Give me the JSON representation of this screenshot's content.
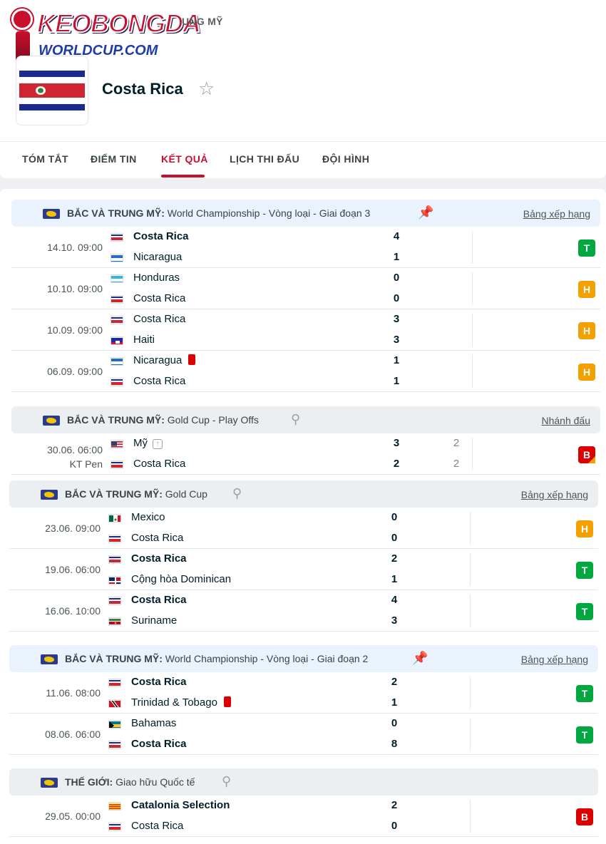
{
  "breadcrumb": "UNG MỸ",
  "logo": {
    "line1": "KEOBONGDA",
    "line2": "WORLDCUP.COM"
  },
  "team": {
    "name": "Costa Rica",
    "flag": "cr"
  },
  "tabs": [
    {
      "label": "TÓM TẮT"
    },
    {
      "label": "ĐIỂM TIN"
    },
    {
      "label": "KẾT QUẢ"
    },
    {
      "label": "LỊCH THI ĐẤU"
    },
    {
      "label": "ĐỘI HÌNH"
    }
  ],
  "sections": [
    {
      "region": "BẮC VÀ TRUNG MỸ:",
      "competition": "World Championship - Vòng loại - Giai đoạn 3",
      "pinned": true,
      "link": "Bảng xếp hạng",
      "matches": [
        {
          "time": "14.10. 09:00",
          "home": "Costa Rica",
          "home_flag": "cr",
          "away": "Nicaragua",
          "away_flag": "ni",
          "hs": "4",
          "as": "1",
          "result": "T",
          "winner": "home"
        },
        {
          "time": "10.10. 09:00",
          "home": "Honduras",
          "home_flag": "hn",
          "away": "Costa Rica",
          "away_flag": "cr",
          "hs": "0",
          "as": "0",
          "result": "H"
        },
        {
          "time": "10.09. 09:00",
          "home": "Costa Rica",
          "home_flag": "cr",
          "away": "Haiti",
          "away_flag": "ht",
          "hs": "3",
          "as": "3",
          "result": "H"
        },
        {
          "time": "06.09. 09:00",
          "home": "Nicaragua",
          "home_flag": "ni",
          "away": "Costa Rica",
          "away_flag": "cr",
          "hs": "1",
          "as": "1",
          "result": "H",
          "home_redcard": true
        }
      ]
    },
    {
      "region": "BẮC VÀ TRUNG MỸ:",
      "competition": "Gold Cup - Play Offs",
      "pinned": false,
      "link": "Nhánh đấu",
      "matches": [
        {
          "time": "30.06. 06:00",
          "status": "KT Pen",
          "home": "Mỹ",
          "home_flag": "us",
          "away": "Costa Rica",
          "away_flag": "cr",
          "hs": "3",
          "as": "2",
          "hp": "2",
          "ap": "2",
          "result": "B",
          "home_up": true
        }
      ]
    },
    {
      "region": "BẮC VÀ TRUNG MỸ:",
      "competition": "Gold Cup",
      "pinned": false,
      "link": "Bảng xếp hạng",
      "matches": [
        {
          "time": "23.06. 09:00",
          "home": "Mexico",
          "home_flag": "mx",
          "away": "Costa Rica",
          "away_flag": "cr",
          "hs": "0",
          "as": "0",
          "result": "H"
        },
        {
          "time": "19.06. 06:00",
          "home": "Costa Rica",
          "home_flag": "cr",
          "away": "Cộng hòa Dominican",
          "away_flag": "do",
          "hs": "2",
          "as": "1",
          "result": "T",
          "winner": "home"
        },
        {
          "time": "16.06. 10:00",
          "home": "Costa Rica",
          "home_flag": "cr",
          "away": "Suriname",
          "away_flag": "sr",
          "hs": "4",
          "as": "3",
          "result": "T",
          "winner": "home"
        }
      ]
    },
    {
      "region": "BẮC VÀ TRUNG MỸ:",
      "competition": "World Championship - Vòng loại - Giai đoạn 2",
      "pinned": true,
      "link": "Bảng xếp hạng",
      "matches": [
        {
          "time": "11.06. 08:00",
          "home": "Costa Rica",
          "home_flag": "cr",
          "away": "Trinidad & Tobago",
          "away_flag": "tt",
          "hs": "2",
          "as": "1",
          "result": "T",
          "winner": "home",
          "away_redcard": true
        },
        {
          "time": "08.06. 06:00",
          "home": "Bahamas",
          "home_flag": "bs",
          "away": "Costa Rica",
          "away_flag": "cr",
          "hs": "0",
          "as": "8",
          "result": "T",
          "winner": "away"
        }
      ]
    },
    {
      "region": "THẾ GIỚI:",
      "competition": "Giao hữu Quốc tế",
      "pinned": false,
      "link": "",
      "matches": [
        {
          "time": "29.05. 00:00",
          "home": "Catalonia Selection",
          "home_flag": "ct",
          "away": "Costa Rica",
          "away_flag": "cr",
          "hs": "2",
          "as": "0",
          "result": "B",
          "winner": "home"
        }
      ]
    }
  ]
}
